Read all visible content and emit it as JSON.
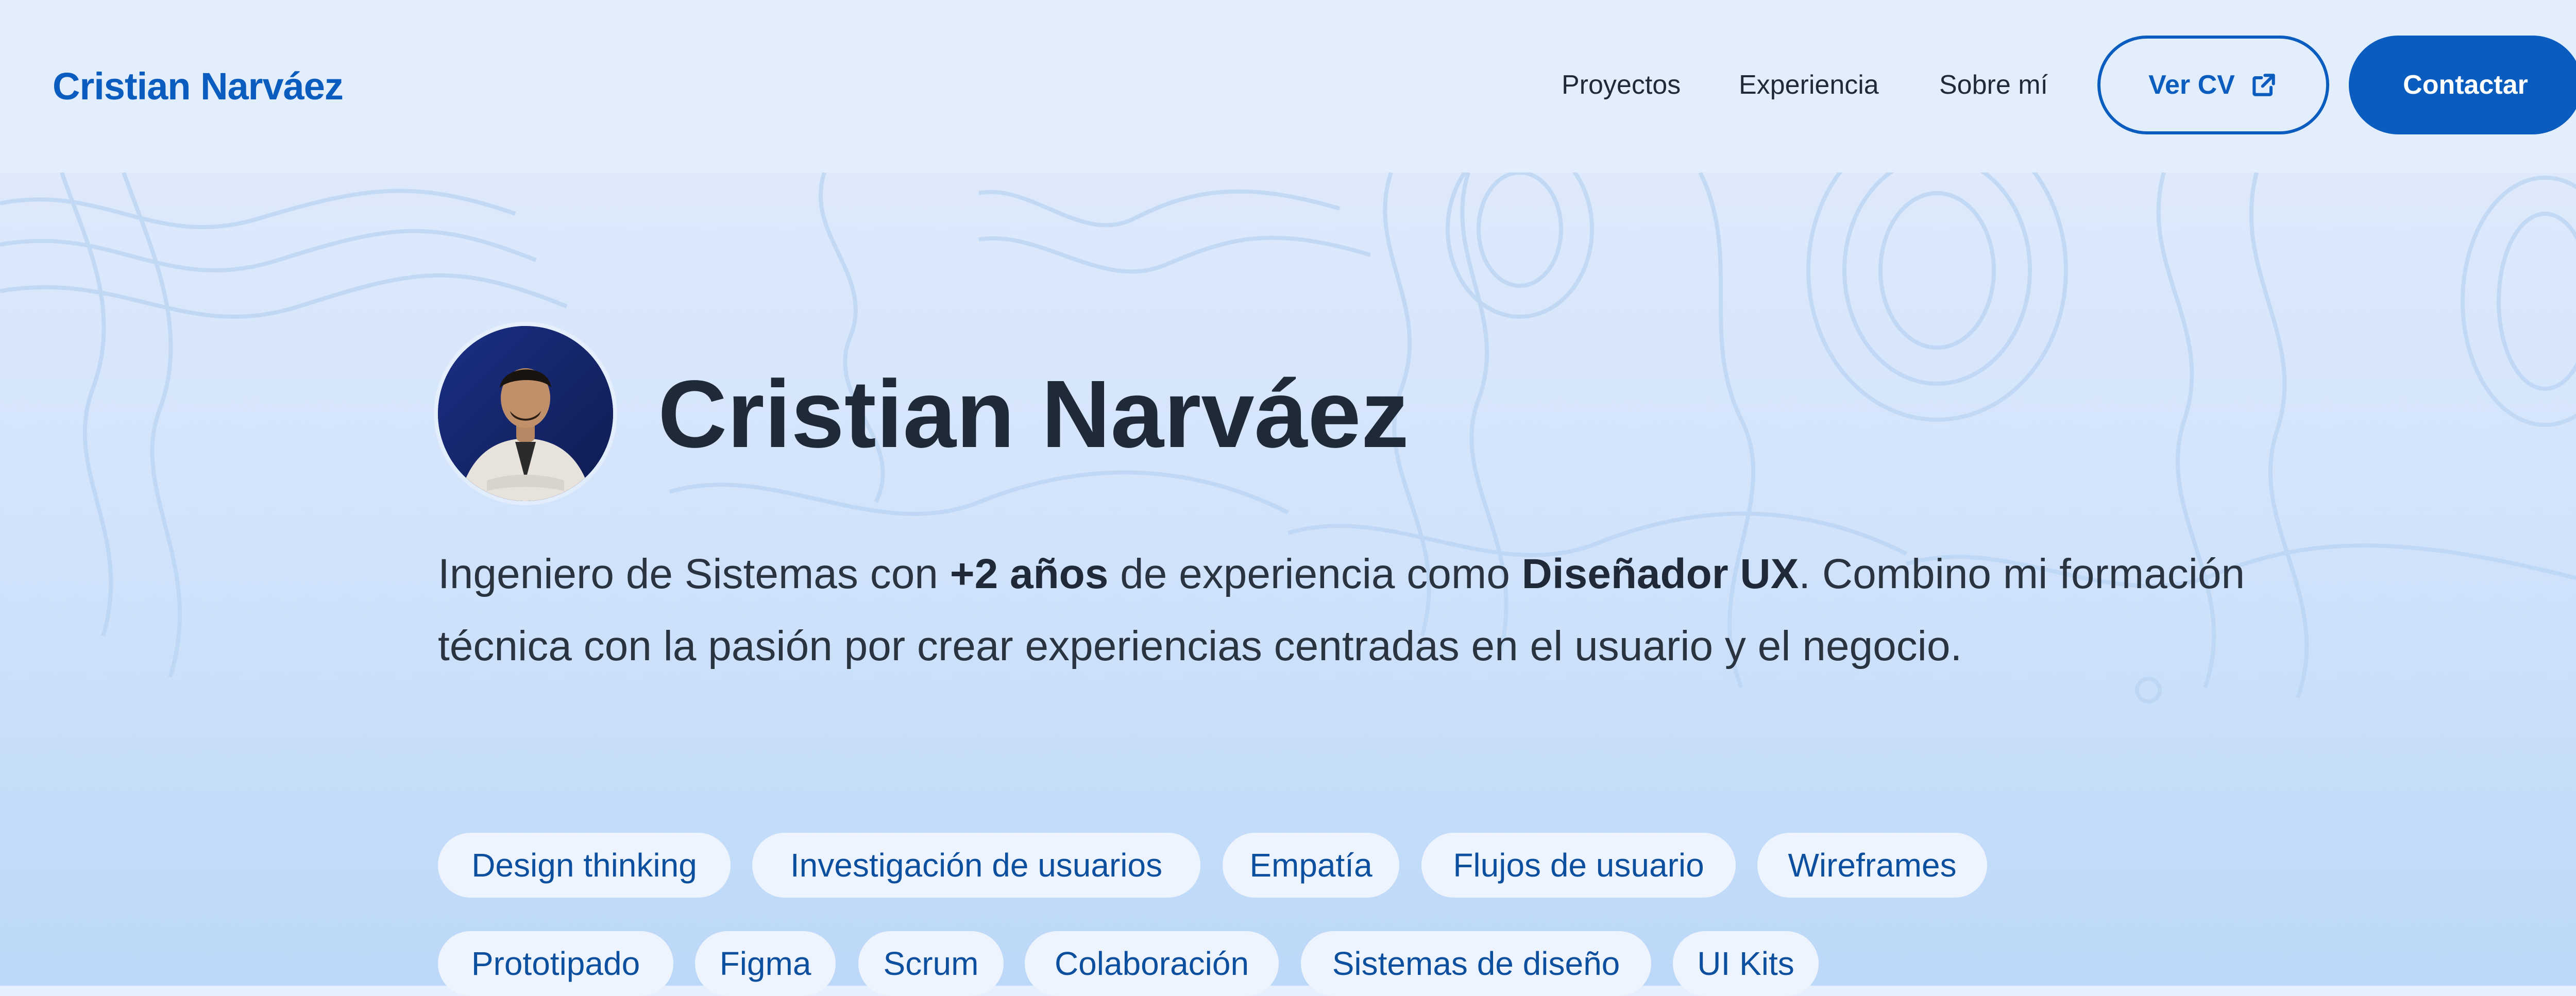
{
  "nav": {
    "logo": "Cristian Narváez",
    "links": [
      "Proyectos",
      "Experiencia",
      "Sobre mí"
    ],
    "cv_button": "Ver CV",
    "contact_button": "Contactar"
  },
  "hero": {
    "name": "Cristian Narváez",
    "bio": {
      "part1": "Ingeniero de Sistemas con ",
      "strong1": "+2 años",
      "part2": " de experiencia como ",
      "strong2": "Diseñador UX",
      "part3": ". Combino mi formación técnica con la pasión por crear experiencias centradas en el usuario y el negocio."
    }
  },
  "skills": [
    "Design thinking",
    "Investigación de usuarios",
    "Empatía",
    "Flujos de usuario",
    "Wireframes",
    "Prototipado",
    "Figma",
    "Scrum",
    "Colaboración",
    "Sistemas de diseño",
    "UI Kits"
  ],
  "icons": {
    "external_link": "external-link-icon",
    "avatar": "profile-photo"
  },
  "colors": {
    "primary": "#0b5cbf",
    "chip_bg": "#eef4fd",
    "chip_text": "#0b4f9e",
    "heading": "#1f2a38"
  }
}
